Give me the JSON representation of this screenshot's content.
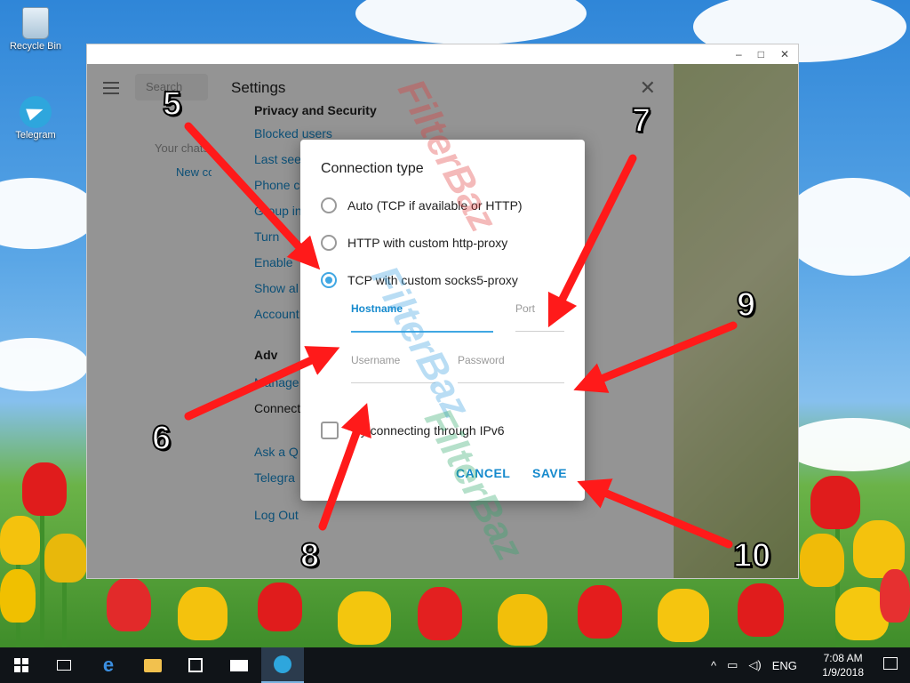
{
  "desktop": {
    "icons": [
      {
        "label": "Recycle Bin"
      },
      {
        "label": "Telegram"
      }
    ]
  },
  "app": {
    "window_controls": {
      "minimize": "–",
      "maximize": "□",
      "close": "✕"
    },
    "sidebar": {
      "search_placeholder": "Search",
      "empty_text": "Your chats",
      "new_contact": "New co"
    },
    "settings": {
      "title": "Settings",
      "close_glyph": "✕",
      "items": [
        {
          "label": "Privacy and Security"
        },
        {
          "label": "Blocked users"
        },
        {
          "label": "Last see"
        },
        {
          "label": "Phone c"
        },
        {
          "label": "Group in"
        },
        {
          "label": "Turn"
        },
        {
          "label": "Enable"
        },
        {
          "label": "Show al"
        },
        {
          "label": "Account"
        },
        {
          "label": "Adv"
        },
        {
          "label": "Manage"
        },
        {
          "label": "Connect"
        },
        {
          "label": "Ask a Q"
        },
        {
          "label": "Telegra"
        },
        {
          "label": "Log Out"
        }
      ]
    }
  },
  "dialog": {
    "title": "Connection type",
    "options": [
      {
        "label": "Auto (TCP if available or HTTP)",
        "selected": false
      },
      {
        "label": "HTTP with custom http-proxy",
        "selected": false
      },
      {
        "label": "TCP with custom socks5-proxy",
        "selected": true
      }
    ],
    "fields": {
      "hostname": {
        "label": "Hostname",
        "value": ""
      },
      "port": {
        "label": "Port",
        "value": ""
      },
      "username": {
        "label": "Username",
        "value": ""
      },
      "password": {
        "label": "Password",
        "value": ""
      }
    },
    "ipv6": {
      "label": "Try connecting through IPv6",
      "checked": false
    },
    "cancel": "CANCEL",
    "save": "SAVE"
  },
  "annotations": [
    "5",
    "6",
    "7",
    "8",
    "9",
    "10"
  ],
  "watermark": "FilterBaz",
  "taskbar": {
    "language": "ENG",
    "time": "7:08 AM",
    "date": "1/9/2018"
  },
  "colors": {
    "accent": "#40a7e3",
    "link": "#168acd",
    "arrow": "#ff1a1a",
    "taskbar": "#101418"
  }
}
